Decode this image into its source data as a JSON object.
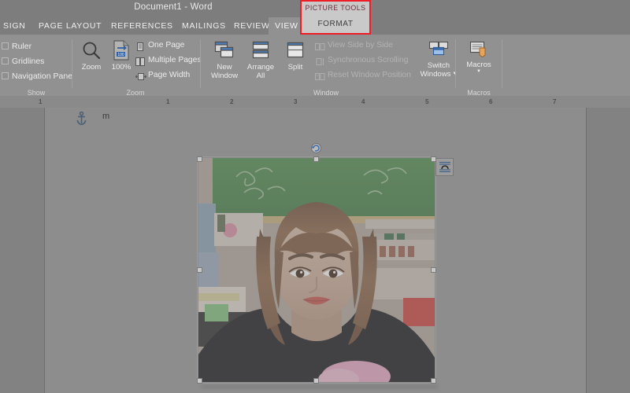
{
  "window": {
    "title": "Document1 - Word"
  },
  "tabs": [
    {
      "label": "SIGN",
      "active": false
    },
    {
      "label": "PAGE LAYOUT",
      "active": false
    },
    {
      "label": "REFERENCES",
      "active": false
    },
    {
      "label": "MAILINGS",
      "active": false
    },
    {
      "label": "REVIEW",
      "active": false
    },
    {
      "label": "VIEW",
      "active": true
    }
  ],
  "contextual_tab": {
    "title": "PICTURE TOOLS",
    "label": "FORMAT",
    "highlight_color": "#ee1c25",
    "background": "#c9c9c9"
  },
  "ribbon": {
    "groups": [
      {
        "name": "Show",
        "label": "Show",
        "checkboxes": [
          {
            "label": "Ruler",
            "checked": false
          },
          {
            "label": "Gridlines",
            "checked": false
          },
          {
            "label": "Navigation Pane",
            "checked": false
          }
        ]
      },
      {
        "name": "Zoom",
        "label": "Zoom",
        "big_buttons": [
          {
            "label": "Zoom",
            "icon": "magnifier-icon"
          },
          {
            "label": "100%",
            "icon": "page-100-percent-icon"
          }
        ],
        "small_items": [
          {
            "label": "One Page",
            "icon": "one-page-icon",
            "disabled": false
          },
          {
            "label": "Multiple Pages",
            "icon": "multiple-pages-icon",
            "disabled": false
          },
          {
            "label": "Page Width",
            "icon": "page-width-icon",
            "disabled": false
          }
        ]
      },
      {
        "name": "Window",
        "label": "Window",
        "big_buttons": [
          {
            "label": "New Window",
            "icon": "new-window-icon"
          },
          {
            "label": "Arrange All",
            "icon": "arrange-all-icon"
          },
          {
            "label": "Split",
            "icon": "split-icon"
          }
        ],
        "small_items": [
          {
            "label": "View Side by Side",
            "icon": "view-side-by-side-icon",
            "disabled": true
          },
          {
            "label": "Synchronous Scrolling",
            "icon": "synchronous-scrolling-icon",
            "disabled": true
          },
          {
            "label": "Reset Window Position",
            "icon": "reset-window-position-icon",
            "disabled": true
          }
        ],
        "dropdown_buttons": [
          {
            "label": "Switch Windows",
            "icon": "switch-windows-icon",
            "caret": "▼"
          }
        ]
      },
      {
        "name": "Macros",
        "label": "Macros",
        "dropdown_buttons": [
          {
            "label": "Macros",
            "icon": "macros-icon",
            "caret": "▼"
          }
        ]
      }
    ]
  },
  "ruler": {
    "unit_marks": [
      "1",
      "1",
      "2",
      "3",
      "4",
      "5",
      "6",
      "7"
    ],
    "left_indent_marker": "hourglass-indent-marker",
    "right_indent_marker": "triangle-indent-marker"
  },
  "document": {
    "anchor_icon": "anchor-icon",
    "body_text": "m",
    "page_background": "#8d8d8d"
  },
  "picture": {
    "alt": "Photo of a young woman with shoulder-length light brown hair wearing a black t-shirt, standing in front of a green chalkboard in a classroom",
    "selected": true,
    "handles": [
      "top-left",
      "top-center",
      "top-right",
      "middle-left",
      "middle-right",
      "bottom-left",
      "bottom-center",
      "bottom-right"
    ],
    "rotation_handle": "rotate-handle-icon",
    "layout_options_button": "layout-options-icon"
  }
}
